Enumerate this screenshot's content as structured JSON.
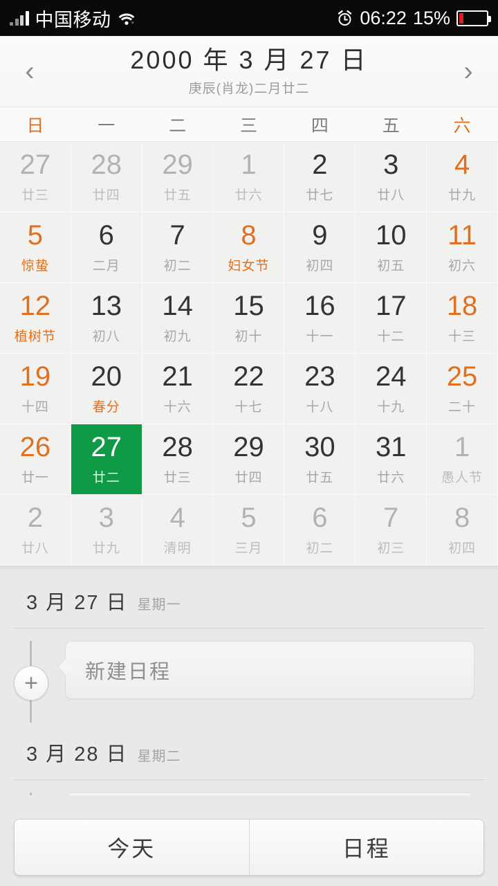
{
  "statusbar": {
    "carrier": "中国移动",
    "signal_icon": "signal-bars-icon",
    "wifi_icon": "wifi-icon",
    "alarm_icon": "alarm-clock-icon",
    "time": "06:22",
    "battery_percent": "15%",
    "battery_icon": "battery-low-icon",
    "battery_fill_color": "#e02020",
    "background": "#0a0a0a"
  },
  "header": {
    "prev_icon": "chevron-left-icon",
    "next_icon": "chevron-right-icon",
    "title": "2000 年 3 月 27 日",
    "subtitle": "庚辰(肖龙)二月廿二"
  },
  "weekdays": [
    {
      "label": "日",
      "weekend": true
    },
    {
      "label": "一",
      "weekend": false
    },
    {
      "label": "二",
      "weekend": false
    },
    {
      "label": "三",
      "weekend": false
    },
    {
      "label": "四",
      "weekend": false
    },
    {
      "label": "五",
      "weekend": false
    },
    {
      "label": "六",
      "weekend": true
    }
  ],
  "colors": {
    "accent_orange": "#e0701f",
    "selected_green": "#0f9a46",
    "cell_background": "#f1f1ef",
    "page_background": "#e9e9e7"
  },
  "calendar": {
    "cells": [
      {
        "day": "27",
        "lunar": "廿三",
        "state": "muted"
      },
      {
        "day": "28",
        "lunar": "廿四",
        "state": "muted"
      },
      {
        "day": "29",
        "lunar": "廿五",
        "state": "muted"
      },
      {
        "day": "1",
        "lunar": "廿六",
        "state": "muted"
      },
      {
        "day": "2",
        "lunar": "廿七",
        "state": "normal"
      },
      {
        "day": "3",
        "lunar": "廿八",
        "state": "normal"
      },
      {
        "day": "4",
        "lunar": "廿九",
        "state": "highlight"
      },
      {
        "day": "5",
        "lunar": "惊蛰",
        "state": "highlight-both"
      },
      {
        "day": "6",
        "lunar": "二月",
        "state": "normal"
      },
      {
        "day": "7",
        "lunar": "初二",
        "state": "normal"
      },
      {
        "day": "8",
        "lunar": "妇女节",
        "state": "highlight-both"
      },
      {
        "day": "9",
        "lunar": "初四",
        "state": "normal"
      },
      {
        "day": "10",
        "lunar": "初五",
        "state": "normal"
      },
      {
        "day": "11",
        "lunar": "初六",
        "state": "highlight"
      },
      {
        "day": "12",
        "lunar": "植树节",
        "state": "highlight-both"
      },
      {
        "day": "13",
        "lunar": "初八",
        "state": "normal"
      },
      {
        "day": "14",
        "lunar": "初九",
        "state": "normal"
      },
      {
        "day": "15",
        "lunar": "初十",
        "state": "normal"
      },
      {
        "day": "16",
        "lunar": "十一",
        "state": "normal"
      },
      {
        "day": "17",
        "lunar": "十二",
        "state": "normal"
      },
      {
        "day": "18",
        "lunar": "十三",
        "state": "highlight"
      },
      {
        "day": "19",
        "lunar": "十四",
        "state": "highlight"
      },
      {
        "day": "20",
        "lunar": "春分",
        "state": "lunar-highlight"
      },
      {
        "day": "21",
        "lunar": "十六",
        "state": "normal"
      },
      {
        "day": "22",
        "lunar": "十七",
        "state": "normal"
      },
      {
        "day": "23",
        "lunar": "十八",
        "state": "normal"
      },
      {
        "day": "24",
        "lunar": "十九",
        "state": "normal"
      },
      {
        "day": "25",
        "lunar": "二十",
        "state": "highlight"
      },
      {
        "day": "26",
        "lunar": "廿一",
        "state": "highlight"
      },
      {
        "day": "27",
        "lunar": "廿二",
        "state": "selected"
      },
      {
        "day": "28",
        "lunar": "廿三",
        "state": "normal"
      },
      {
        "day": "29",
        "lunar": "廿四",
        "state": "normal"
      },
      {
        "day": "30",
        "lunar": "廿五",
        "state": "normal"
      },
      {
        "day": "31",
        "lunar": "廿六",
        "state": "normal"
      },
      {
        "day": "1",
        "lunar": "愚人节",
        "state": "muted"
      },
      {
        "day": "2",
        "lunar": "廿八",
        "state": "muted"
      },
      {
        "day": "3",
        "lunar": "廿九",
        "state": "muted"
      },
      {
        "day": "4",
        "lunar": "清明",
        "state": "muted"
      },
      {
        "day": "5",
        "lunar": "三月",
        "state": "muted"
      },
      {
        "day": "6",
        "lunar": "初二",
        "state": "muted"
      },
      {
        "day": "7",
        "lunar": "初三",
        "state": "muted"
      },
      {
        "day": "8",
        "lunar": "初四",
        "state": "muted"
      }
    ]
  },
  "agenda": {
    "days": [
      {
        "date": "3 月 27 日",
        "weekday": "星期一",
        "add_icon": "plus-icon",
        "event_placeholder": "新建日程"
      },
      {
        "date": "3 月 28 日",
        "weekday": "星期二",
        "add_icon": "plus-icon",
        "event_placeholder": ""
      }
    ]
  },
  "bottombar": {
    "today_label": "今天",
    "schedule_label": "日程"
  }
}
